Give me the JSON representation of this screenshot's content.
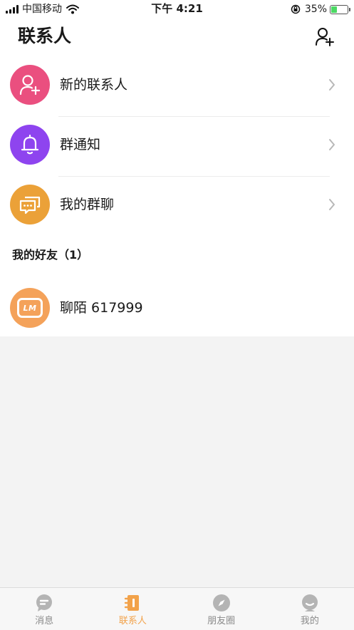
{
  "status_bar": {
    "carrier": "中国移动",
    "time": "下午 4:21",
    "battery_percent": "35%",
    "battery_level": 0.35
  },
  "header": {
    "title": "联系人",
    "add_friend_icon": "add-user-icon"
  },
  "menu": {
    "items": [
      {
        "label": "新的联系人",
        "icon": "add-user-icon",
        "color": "#ea4f7f"
      },
      {
        "label": "群通知",
        "icon": "bell-icon",
        "color": "#8e44ef"
      },
      {
        "label": "我的群聊",
        "icon": "chat-bubbles-icon",
        "color": "#eba138"
      }
    ]
  },
  "friends_section": {
    "title": "我的好友（1）",
    "friends": [
      {
        "name": "聊陌 617999",
        "avatar_text": "LM",
        "avatar_color": "#f4a25a"
      }
    ]
  },
  "tab_bar": {
    "active_color": "#f2a24a",
    "inactive_color": "#b4b4b4",
    "tabs": [
      {
        "label": "消息",
        "icon": "message-icon",
        "active": false
      },
      {
        "label": "联系人",
        "icon": "contacts-book-icon",
        "active": true
      },
      {
        "label": "朋友圈",
        "icon": "compass-icon",
        "active": false
      },
      {
        "label": "我的",
        "icon": "profile-icon",
        "active": false
      }
    ]
  }
}
